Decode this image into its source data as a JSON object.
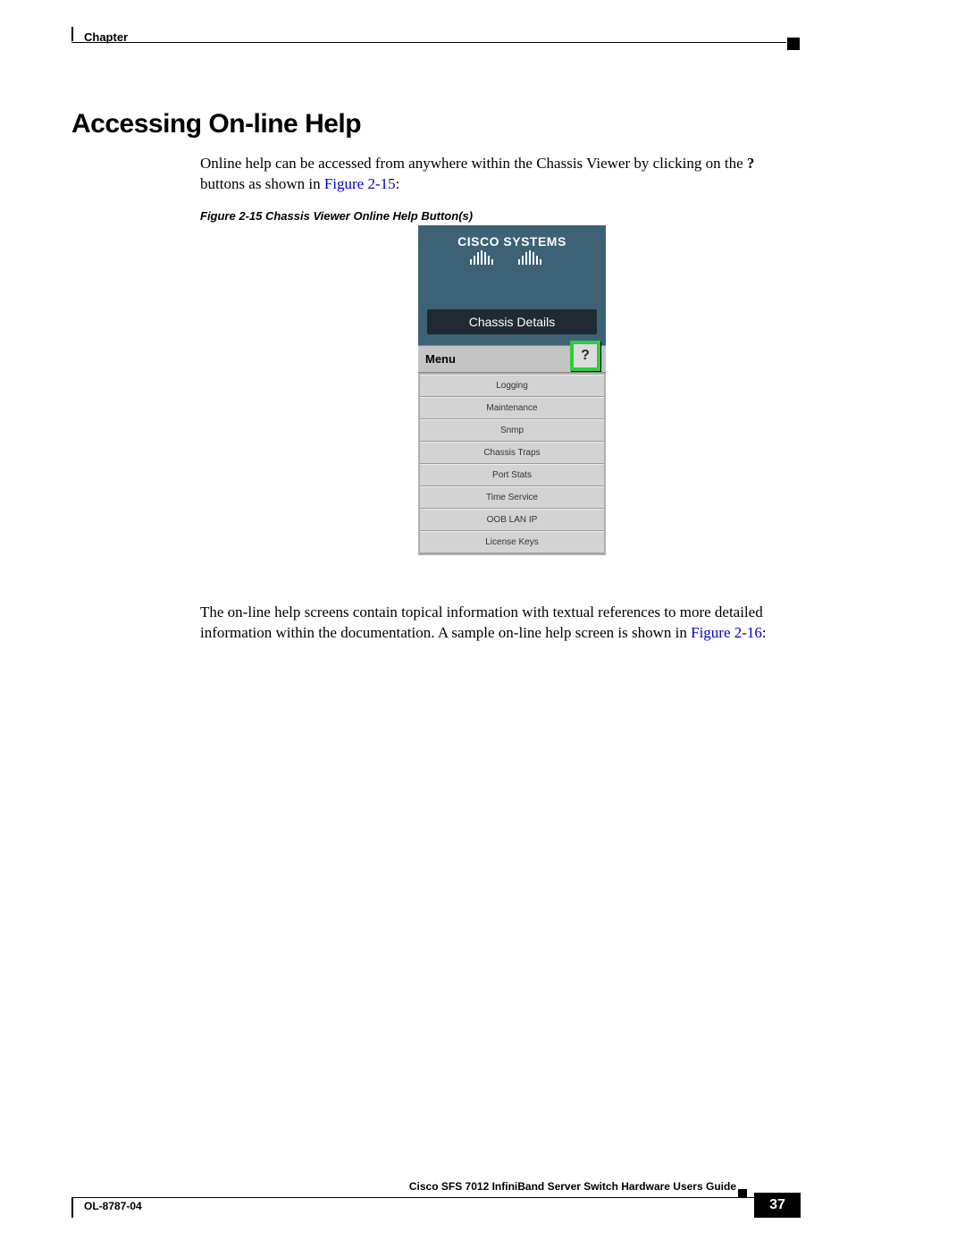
{
  "header": {
    "chapter_label": "Chapter"
  },
  "section": {
    "title": "Accessing On-line Help",
    "para1_pre": "Online help can be accessed from anywhere within the Chassis Viewer by clicking on the ",
    "para1_bold": "?",
    "para1_post": " buttons as shown in ",
    "para1_xref": "Figure 2-15",
    "para1_tail": ":",
    "figcaption": "Figure 2-15   Chassis Viewer Online Help Button(s)",
    "para2_pre": "The on-line help screens contain topical information with textual references to more detailed information within the documentation. A sample on-line help screen is shown in ",
    "para2_xref": "Figure 2-16",
    "para2_tail": ":"
  },
  "figure": {
    "logo_text": "CISCO SYSTEMS",
    "chassis_details": "Chassis Details",
    "menu_label": "Menu",
    "help_glyph": "?",
    "items": {
      "0": "Logging",
      "1": "Maintenance",
      "2": "Snmp",
      "3": "Chassis Traps",
      "4": "Port Stats",
      "5": "Time Service",
      "6": "OOB LAN IP",
      "7": "License Keys"
    }
  },
  "footer": {
    "title": "Cisco SFS 7012 InfiniBand Server Switch Hardware Users Guide",
    "doc_id": "OL-8787-04",
    "page_number": "37"
  }
}
